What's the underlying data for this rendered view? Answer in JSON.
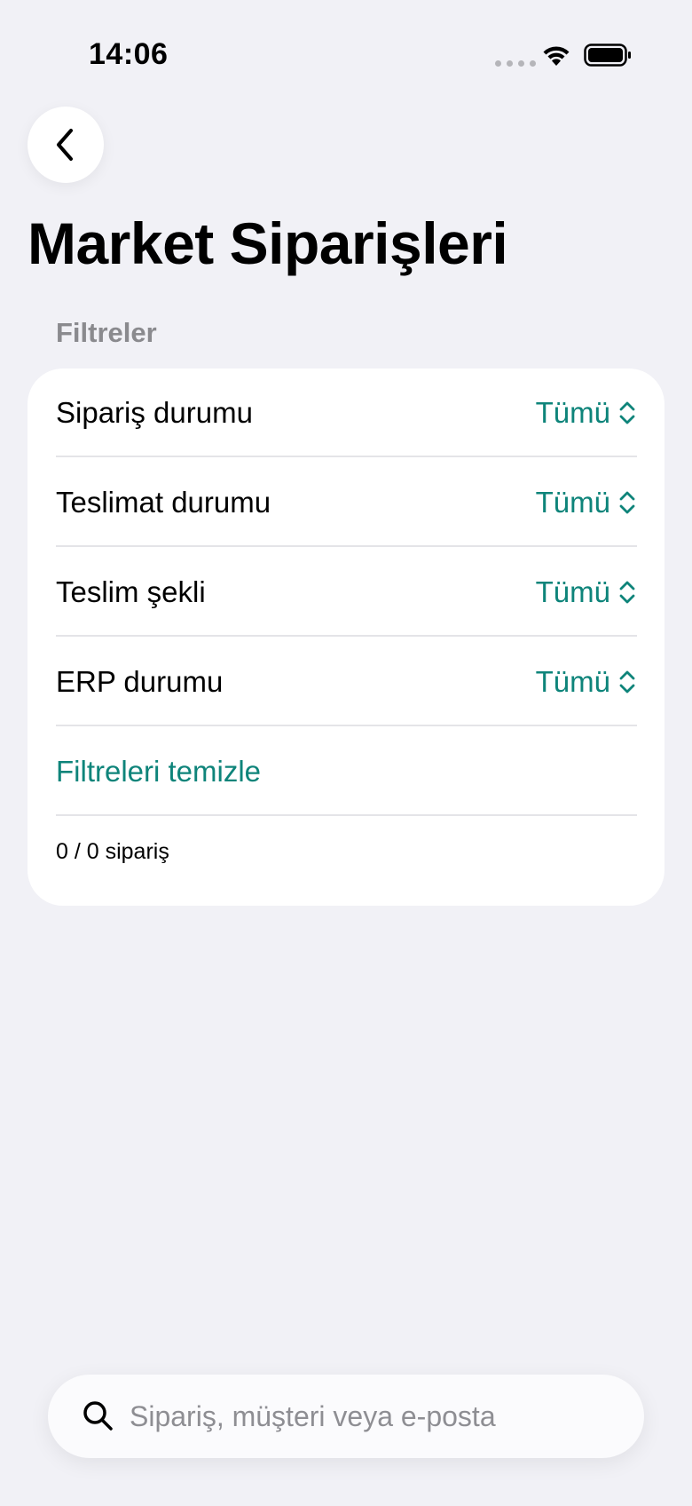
{
  "status_bar": {
    "time": "14:06"
  },
  "header": {
    "back_icon": "chevron-left-icon",
    "title": "Market Siparişleri"
  },
  "filters": {
    "section_title": "Filtreler",
    "rows": [
      {
        "label": "Sipariş durumu",
        "value": "Tümü"
      },
      {
        "label": "Teslimat durumu",
        "value": "Tümü"
      },
      {
        "label": "Teslim şekli",
        "value": "Tümü"
      },
      {
        "label": "ERP durumu",
        "value": "Tümü"
      }
    ],
    "clear_label": "Filtreleri temizle",
    "count_text": "0 / 0 sipariş"
  },
  "search": {
    "placeholder": "Sipariş, müşteri veya e-posta",
    "value": ""
  },
  "colors": {
    "accent": "#0E847A",
    "background": "#F1F1F6",
    "card": "#FFFFFF",
    "secondary_text": "#8A8A8E"
  }
}
